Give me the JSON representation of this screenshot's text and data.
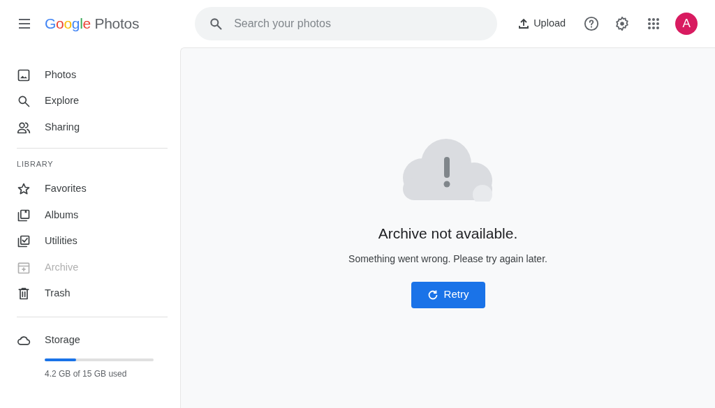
{
  "header": {
    "logo": {
      "brand": "Google",
      "product": "Photos"
    },
    "search": {
      "placeholder": "Search your photos"
    },
    "upload": "Upload",
    "avatar": "A"
  },
  "sidebar": {
    "nav": [
      {
        "label": "Photos",
        "disabled": false
      },
      {
        "label": "Explore",
        "disabled": false
      },
      {
        "label": "Sharing",
        "disabled": false
      }
    ],
    "library_heading": "LIBRARY",
    "library": [
      {
        "label": "Favorites",
        "disabled": false
      },
      {
        "label": "Albums",
        "disabled": false
      },
      {
        "label": "Utilities",
        "disabled": false
      },
      {
        "label": "Archive",
        "disabled": true
      },
      {
        "label": "Trash",
        "disabled": false
      }
    ],
    "storage": {
      "label": "Storage",
      "level": 0.29,
      "usage": "4.2 GB of 15 GB used"
    }
  },
  "main": {
    "title": "Archive not available.",
    "message": "Something went wrong. Please try again later.",
    "retry": "Retry"
  }
}
